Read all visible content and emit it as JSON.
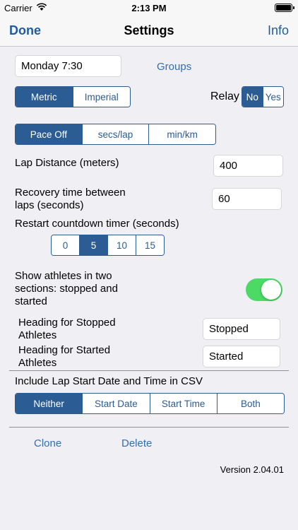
{
  "status": {
    "carrier": "Carrier",
    "time": "2:13 PM"
  },
  "nav": {
    "left": "Done",
    "title": "Settings",
    "right": "Info"
  },
  "session_field": {
    "value": "Monday 7:30"
  },
  "groups_link": "Groups",
  "units": {
    "options": [
      "Metric",
      "Imperial"
    ],
    "selected": "Metric"
  },
  "relay": {
    "label": "Relay",
    "options": [
      "No",
      "Yes"
    ],
    "selected": "No"
  },
  "pace": {
    "options": [
      "Pace Off",
      "secs/lap",
      "min/km"
    ],
    "selected": "Pace Off"
  },
  "lap_distance": {
    "label": "Lap Distance (meters)",
    "value": "400"
  },
  "recovery": {
    "label_line1": "Recovery time between",
    "label_line2": "laps (seconds)",
    "value": "60"
  },
  "restart": {
    "label": "Restart countdown timer (seconds)",
    "options": [
      "0",
      "5",
      "10",
      "15"
    ],
    "selected": "5"
  },
  "show_two_sections": {
    "line1": "Show athletes in two",
    "line2": "sections: stopped and",
    "line3": "started",
    "on": true
  },
  "heading_stopped": {
    "line1": "Heading for Stopped",
    "line2": "Athletes",
    "value": "Stopped"
  },
  "heading_started": {
    "line1": "Heading for Started",
    "line2": "Athletes",
    "value": "Started"
  },
  "csv": {
    "label": "Include Lap Start Date and Time in CSV",
    "options": [
      "Neither",
      "Start Date",
      "Start Time",
      "Both"
    ],
    "selected": "Neither"
  },
  "actions": {
    "clone": "Clone",
    "delete": "Delete"
  },
  "version": "Version 2.04.01",
  "colors": {
    "accent": "#2b5c94",
    "toggle_on": "#4cd964",
    "background": "#efeff4"
  }
}
